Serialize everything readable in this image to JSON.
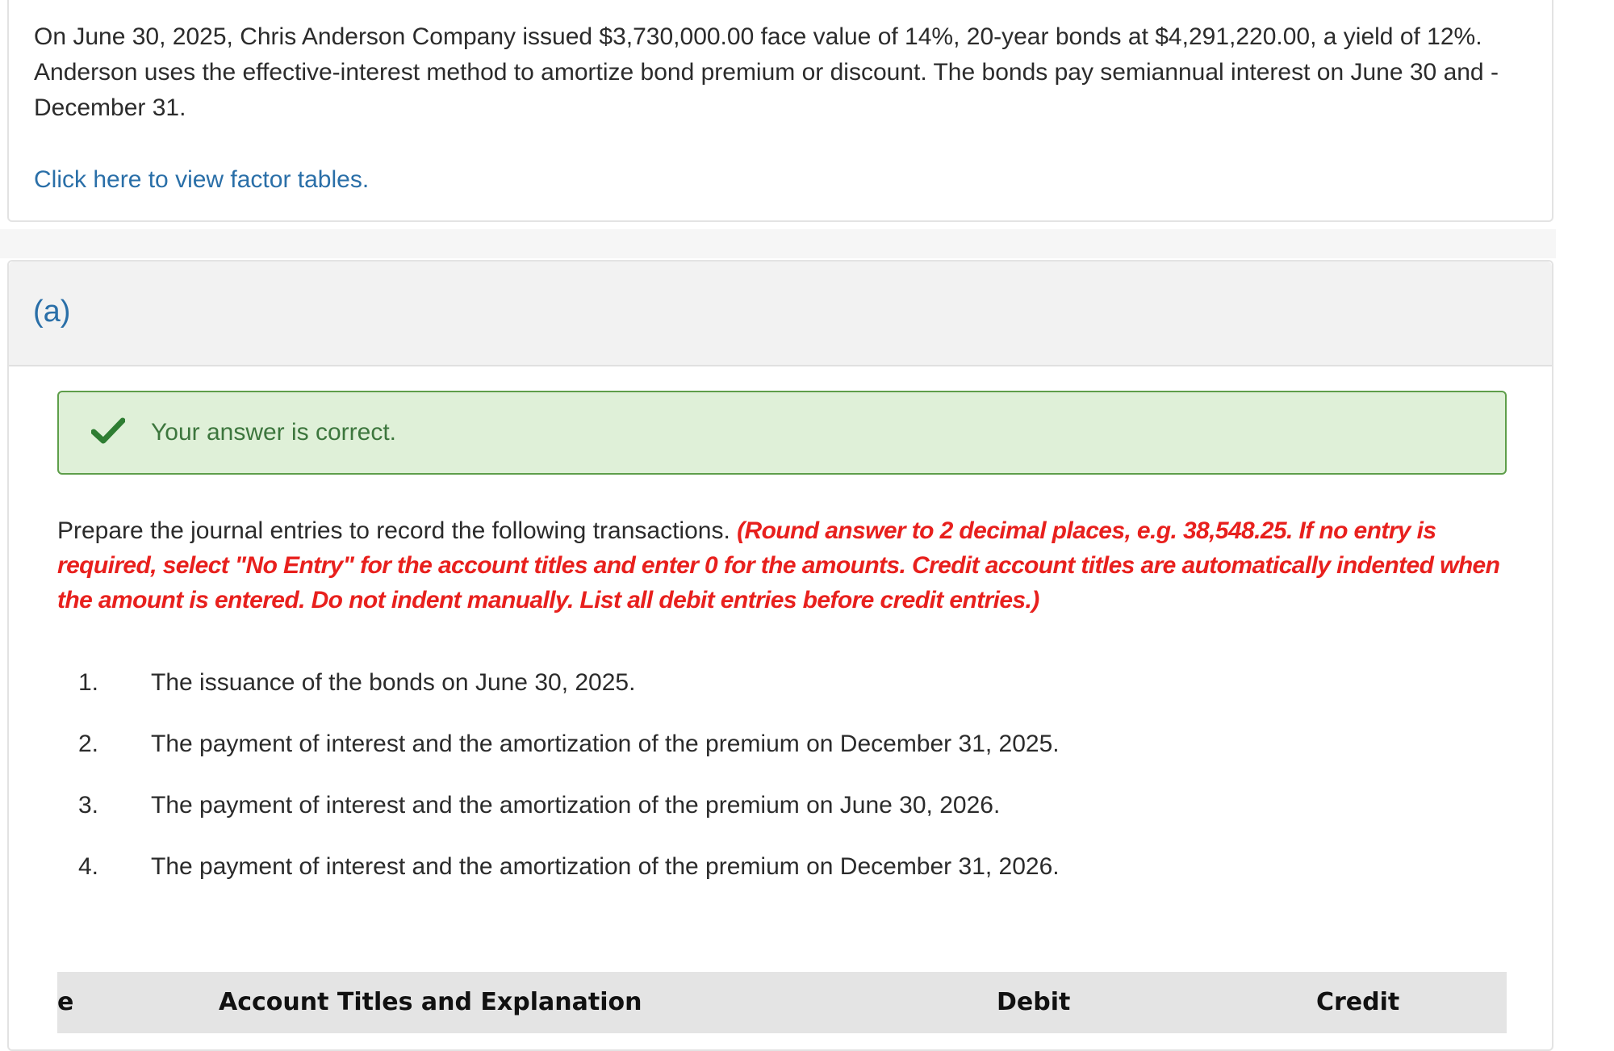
{
  "problem": {
    "text": "On June 30, 2025, Chris Anderson Company issued $3,730,000.00 face value of 14%, 20-year bonds at $4,291,220.00, a yield of 12%. Anderson uses the effective-interest method to amortize bond premium or discount. The bonds pay semiannual interest on June 30 and -December 31.",
    "factor_link": "Click here to view factor tables."
  },
  "section": {
    "label": "(a)",
    "feedback": "Your answer is correct.",
    "instruction_plain": "Prepare the journal entries to record the following transactions. ",
    "instruction_red": "(Round answer to 2 decimal places, e.g. 38,548.25. If no entry is required, select \"No Entry\" for the account titles and enter 0 for the amounts. Credit account titles are automatically indented when the amount is entered. Do not indent manually. List all debit entries before credit entries.)",
    "tasks": [
      {
        "num": "1.",
        "text": "The issuance of the bonds on June 30, 2025."
      },
      {
        "num": "2.",
        "text": "The payment of interest and the amortization of the premium on December 31, 2025."
      },
      {
        "num": "3.",
        "text": "The payment of interest and the amortization of the premium on June 30, 2026."
      },
      {
        "num": "4.",
        "text": "The payment of interest and the amortization of the premium on December 31, 2026."
      }
    ]
  },
  "table": {
    "columns": [
      "e",
      "Account Titles and Explanation",
      "Debit",
      "Credit"
    ]
  },
  "colors": {
    "link": "#2a6fa8",
    "success_bg": "#dff0d8",
    "success_border": "#5e9e4a",
    "success_text": "#3c763d",
    "instruction_red": "#e8201d",
    "check": "#2e7d32"
  },
  "icons": {
    "feedback": "check-icon"
  }
}
